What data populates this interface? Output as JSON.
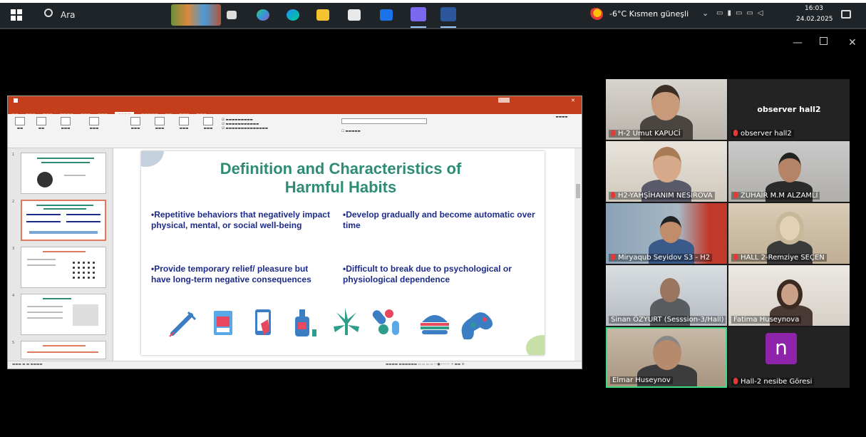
{
  "taskbar": {
    "search_label": "Ara",
    "weather": "-6°C  Kısmen güneşli",
    "time": "16:03",
    "date": "24.02.2025"
  },
  "powerpoint": {
    "slide": {
      "title_line1": "Definition and Characteristics of",
      "title_line2": "Harmful Habits",
      "bullets": [
        "•Repetitive behaviors that negatively impact physical, mental, or social well-being",
        "•Develop gradually and become automatic over time",
        "•Provide temporary relief/ pleasure but have long-term negative consequences",
        "•Difficult to break due to psychological or physiological dependence"
      ],
      "icons": [
        "syringe-icon",
        "pill-box-icon",
        "phone-icon",
        "bottle-icon",
        "cannabis-leaf-icon",
        "pills-icon",
        "burger-icon",
        "gamepad-icon"
      ]
    },
    "thumb_numbers": [
      "1",
      "2",
      "3",
      "4",
      "5"
    ]
  },
  "participants": [
    {
      "name": "H-2 Umut KAPUCİ",
      "muted": true
    },
    {
      "name": "observer hall2",
      "muted": true,
      "caption": "observer hall2"
    },
    {
      "name": "H2-YAHŞİHANIM NESİROVA",
      "muted": true
    },
    {
      "name": "ZUHAİR M.M ALZAMLİ",
      "muted": true
    },
    {
      "name": "Miryaqub Seyidov S3 - H2",
      "muted": true
    },
    {
      "name": "HALL 2-Remziye SEÇEN",
      "muted": true
    },
    {
      "name": "Sinan ÖZYURT (Sesssion-3/Hall)",
      "muted": false
    },
    {
      "name": "Fatima Huseynova",
      "muted": false
    },
    {
      "name": "Elmar Huseynov",
      "muted": false
    },
    {
      "name": "Hall-2 nesibe Göresi",
      "muted": true,
      "avatar_letter": "n"
    }
  ]
}
